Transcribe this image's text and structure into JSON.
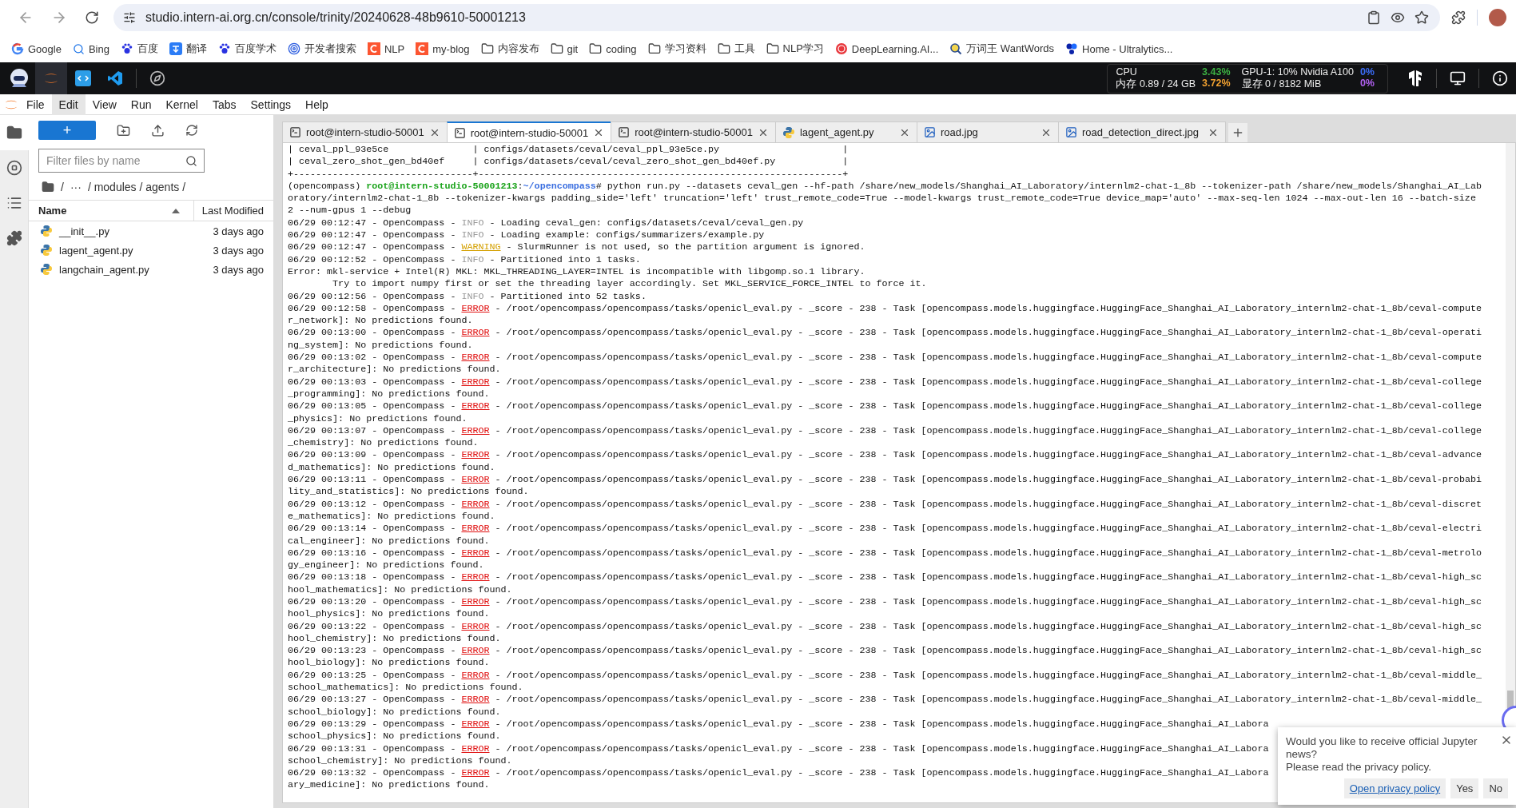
{
  "browser": {
    "url": "studio.intern-ai.org.cn/console/trinity/20240628-48b9610-50001213"
  },
  "bookmarks": [
    {
      "label": "Google",
      "kind": "google"
    },
    {
      "label": "Bing",
      "kind": "search"
    },
    {
      "label": "百度",
      "kind": "paw"
    },
    {
      "label": "翻译",
      "kind": "translate"
    },
    {
      "label": "百度学术",
      "kind": "paw"
    },
    {
      "label": "开发者搜索",
      "kind": "target"
    },
    {
      "label": "NLP",
      "kind": "csdn"
    },
    {
      "label": "my-blog",
      "kind": "csdn"
    },
    {
      "label": "内容发布",
      "kind": "folder"
    },
    {
      "label": "git",
      "kind": "folder"
    },
    {
      "label": "coding",
      "kind": "folder"
    },
    {
      "label": "学习资料",
      "kind": "folder"
    },
    {
      "label": "工具",
      "kind": "folder"
    },
    {
      "label": "NLP学习",
      "kind": "folder"
    },
    {
      "label": "DeepLearning.AI...",
      "kind": "ring"
    },
    {
      "label": "万词王 WantWords",
      "kind": "magnifier"
    },
    {
      "label": "Home - Ultralytics...",
      "kind": "butterfly"
    }
  ],
  "resources": [
    {
      "label": "CPU",
      "value": "3.43%",
      "color": "#3cb043"
    },
    {
      "label": "GPU-1: 10% Nvidia A100",
      "value": "0%",
      "color": "#3b6cf6"
    },
    {
      "label": "内存 0.89 / 24 GB",
      "value": "3.72%",
      "color": "#f0a030"
    },
    {
      "label": "显存 0 / 8182 MiB",
      "value": "0%",
      "color": "#b060f0"
    }
  ],
  "menu": [
    {
      "label": "File",
      "selected": false
    },
    {
      "label": "Edit",
      "selected": true
    },
    {
      "label": "View",
      "selected": false
    },
    {
      "label": "Run",
      "selected": false
    },
    {
      "label": "Kernel",
      "selected": false
    },
    {
      "label": "Tabs",
      "selected": false
    },
    {
      "label": "Settings",
      "selected": false
    },
    {
      "label": "Help",
      "selected": false
    }
  ],
  "side_tabs": [
    {
      "kind": "folder",
      "selected": true
    },
    {
      "kind": "stop",
      "selected": false
    },
    {
      "kind": "list",
      "selected": false
    },
    {
      "kind": "puzzle",
      "selected": false
    }
  ],
  "file_browser": {
    "new_button": "+",
    "filter": {
      "placeholder": "Filter files by name"
    },
    "breadcrumb": [
      "/",
      "···",
      "/ modules / agents /"
    ],
    "columns": [
      "Name",
      "Last Modified"
    ],
    "files": [
      {
        "name": "__init__.py",
        "modified": "3 days ago"
      },
      {
        "name": "lagent_agent.py",
        "modified": "3 days ago"
      },
      {
        "name": "langchain_agent.py",
        "modified": "3 days ago"
      }
    ]
  },
  "tabs": [
    {
      "kind": "terminal",
      "label": "root@intern-studio-50001",
      "selected": false
    },
    {
      "kind": "terminal",
      "label": "root@intern-studio-50001",
      "selected": true
    },
    {
      "kind": "terminal",
      "label": "root@intern-studio-50001",
      "selected": false
    },
    {
      "kind": "python",
      "label": "lagent_agent.py",
      "selected": false
    },
    {
      "kind": "image",
      "label": "road.jpg",
      "selected": false
    },
    {
      "kind": "image",
      "label": "road_detection_direct.jpg",
      "selected": false
    }
  ],
  "terminal": [
    {
      "kind": "text",
      "text": "| ceval_ppl_93e5ce               | configs/datasets/ceval/ceval_ppl_93e5ce.py                      |"
    },
    {
      "kind": "text",
      "text": "| ceval_zero_shot_gen_bd40ef     | configs/datasets/ceval/ceval_zero_shot_gen_bd40ef.py            |"
    },
    {
      "kind": "text",
      "text": "+--------------------------------+-----------------------------------------------------------------+"
    },
    {
      "kind": "prompt",
      "env": "(opencompass) ",
      "user": "root@intern-studio-50001213",
      "sep": ":",
      "path": "~/opencompass",
      "cmd": "# python run.py --datasets ceval_gen --hf-path /share/new_models/Shanghai_AI_Laboratory/internlm2-chat-1_8b --tokenizer-path /share/new_models/Shanghai_AI_Lab"
    },
    {
      "kind": "text",
      "text": "oratory/internlm2-chat-1_8b --tokenizer-kwargs padding_side='left' truncation='left' trust_remote_code=True --model-kwargs trust_remote_code=True device_map='auto' --max-seq-len 1024 --max-out-len 16 --batch-size"
    },
    {
      "kind": "text",
      "text": "2 --num-gpus 1 --debug"
    },
    {
      "kind": "info",
      "head": "06/29 00:12:47 - OpenCompass - ",
      "level": "INFO",
      "tail": " - Loading ceval_gen: configs/datasets/ceval/ceval_gen.py"
    },
    {
      "kind": "info",
      "head": "06/29 00:12:47 - OpenCompass - ",
      "level": "INFO",
      "tail": " - Loading example: configs/summarizers/example.py"
    },
    {
      "kind": "warning",
      "head": "06/29 00:12:47 - OpenCompass - ",
      "level": "WARNING",
      "tail": " - SlurmRunner is not used, so the partition argument is ignored."
    },
    {
      "kind": "info",
      "head": "06/29 00:12:52 - OpenCompass - ",
      "level": "INFO",
      "tail": " - Partitioned into 1 tasks."
    },
    {
      "kind": "text",
      "text": "Error: mkl-service + Intel(R) MKL: MKL_THREADING_LAYER=INTEL is incompatible with libgomp.so.1 library."
    },
    {
      "kind": "text",
      "text": "        Try to import numpy first or set the threading layer accordingly. Set MKL_SERVICE_FORCE_INTEL to force it."
    },
    {
      "kind": "info",
      "head": "06/29 00:12:56 - OpenCompass - ",
      "level": "INFO",
      "tail": " - Partitioned into 52 tasks."
    },
    {
      "kind": "error",
      "head": "06/29 00:12:58 - OpenCompass - ",
      "level": "ERROR",
      "tail": " - /root/opencompass/opencompass/tasks/openicl_eval.py - _score - 238 - Task [opencompass.models.huggingface.HuggingFace_Shanghai_AI_Laboratory_internlm2-chat-1_8b/ceval-compute"
    },
    {
      "kind": "text",
      "text": "r_network]: No predictions found."
    },
    {
      "kind": "error",
      "head": "06/29 00:13:00 - OpenCompass - ",
      "level": "ERROR",
      "tail": " - /root/opencompass/opencompass/tasks/openicl_eval.py - _score - 238 - Task [opencompass.models.huggingface.HuggingFace_Shanghai_AI_Laboratory_internlm2-chat-1_8b/ceval-operati"
    },
    {
      "kind": "text",
      "text": "ng_system]: No predictions found."
    },
    {
      "kind": "error",
      "head": "06/29 00:13:02 - OpenCompass - ",
      "level": "ERROR",
      "tail": " - /root/opencompass/opencompass/tasks/openicl_eval.py - _score - 238 - Task [opencompass.models.huggingface.HuggingFace_Shanghai_AI_Laboratory_internlm2-chat-1_8b/ceval-compute"
    },
    {
      "kind": "text",
      "text": "r_architecture]: No predictions found."
    },
    {
      "kind": "error",
      "head": "06/29 00:13:03 - OpenCompass - ",
      "level": "ERROR",
      "tail": " - /root/opencompass/opencompass/tasks/openicl_eval.py - _score - 238 - Task [opencompass.models.huggingface.HuggingFace_Shanghai_AI_Laboratory_internlm2-chat-1_8b/ceval-college"
    },
    {
      "kind": "text",
      "text": "_programming]: No predictions found."
    },
    {
      "kind": "error",
      "head": "06/29 00:13:05 - OpenCompass - ",
      "level": "ERROR",
      "tail": " - /root/opencompass/opencompass/tasks/openicl_eval.py - _score - 238 - Task [opencompass.models.huggingface.HuggingFace_Shanghai_AI_Laboratory_internlm2-chat-1_8b/ceval-college"
    },
    {
      "kind": "text",
      "text": "_physics]: No predictions found."
    },
    {
      "kind": "error",
      "head": "06/29 00:13:07 - OpenCompass - ",
      "level": "ERROR",
      "tail": " - /root/opencompass/opencompass/tasks/openicl_eval.py - _score - 238 - Task [opencompass.models.huggingface.HuggingFace_Shanghai_AI_Laboratory_internlm2-chat-1_8b/ceval-college"
    },
    {
      "kind": "text",
      "text": "_chemistry]: No predictions found."
    },
    {
      "kind": "error",
      "head": "06/29 00:13:09 - OpenCompass - ",
      "level": "ERROR",
      "tail": " - /root/opencompass/opencompass/tasks/openicl_eval.py - _score - 238 - Task [opencompass.models.huggingface.HuggingFace_Shanghai_AI_Laboratory_internlm2-chat-1_8b/ceval-advance"
    },
    {
      "kind": "text",
      "text": "d_mathematics]: No predictions found."
    },
    {
      "kind": "error",
      "head": "06/29 00:13:11 - OpenCompass - ",
      "level": "ERROR",
      "tail": " - /root/opencompass/opencompass/tasks/openicl_eval.py - _score - 238 - Task [opencompass.models.huggingface.HuggingFace_Shanghai_AI_Laboratory_internlm2-chat-1_8b/ceval-probabi"
    },
    {
      "kind": "text",
      "text": "lity_and_statistics]: No predictions found."
    },
    {
      "kind": "error",
      "head": "06/29 00:13:12 - OpenCompass - ",
      "level": "ERROR",
      "tail": " - /root/opencompass/opencompass/tasks/openicl_eval.py - _score - 238 - Task [opencompass.models.huggingface.HuggingFace_Shanghai_AI_Laboratory_internlm2-chat-1_8b/ceval-discret"
    },
    {
      "kind": "text",
      "text": "e_mathematics]: No predictions found."
    },
    {
      "kind": "error",
      "head": "06/29 00:13:14 - OpenCompass - ",
      "level": "ERROR",
      "tail": " - /root/opencompass/opencompass/tasks/openicl_eval.py - _score - 238 - Task [opencompass.models.huggingface.HuggingFace_Shanghai_AI_Laboratory_internlm2-chat-1_8b/ceval-electri"
    },
    {
      "kind": "text",
      "text": "cal_engineer]: No predictions found."
    },
    {
      "kind": "error",
      "head": "06/29 00:13:16 - OpenCompass - ",
      "level": "ERROR",
      "tail": " - /root/opencompass/opencompass/tasks/openicl_eval.py - _score - 238 - Task [opencompass.models.huggingface.HuggingFace_Shanghai_AI_Laboratory_internlm2-chat-1_8b/ceval-metrolo"
    },
    {
      "kind": "text",
      "text": "gy_engineer]: No predictions found."
    },
    {
      "kind": "error",
      "head": "06/29 00:13:18 - OpenCompass - ",
      "level": "ERROR",
      "tail": " - /root/opencompass/opencompass/tasks/openicl_eval.py - _score - 238 - Task [opencompass.models.huggingface.HuggingFace_Shanghai_AI_Laboratory_internlm2-chat-1_8b/ceval-high_sc"
    },
    {
      "kind": "text",
      "text": "hool_mathematics]: No predictions found."
    },
    {
      "kind": "error",
      "head": "06/29 00:13:20 - OpenCompass - ",
      "level": "ERROR",
      "tail": " - /root/opencompass/opencompass/tasks/openicl_eval.py - _score - 238 - Task [opencompass.models.huggingface.HuggingFace_Shanghai_AI_Laboratory_internlm2-chat-1_8b/ceval-high_sc"
    },
    {
      "kind": "text",
      "text": "hool_physics]: No predictions found."
    },
    {
      "kind": "error",
      "head": "06/29 00:13:22 - OpenCompass - ",
      "level": "ERROR",
      "tail": " - /root/opencompass/opencompass/tasks/openicl_eval.py - _score - 238 - Task [opencompass.models.huggingface.HuggingFace_Shanghai_AI_Laboratory_internlm2-chat-1_8b/ceval-high_sc"
    },
    {
      "kind": "text",
      "text": "hool_chemistry]: No predictions found."
    },
    {
      "kind": "error",
      "head": "06/29 00:13:23 - OpenCompass - ",
      "level": "ERROR",
      "tail": " - /root/opencompass/opencompass/tasks/openicl_eval.py - _score - 238 - Task [opencompass.models.huggingface.HuggingFace_Shanghai_AI_Laboratory_internlm2-chat-1_8b/ceval-high_sc"
    },
    {
      "kind": "text",
      "text": "hool_biology]: No predictions found."
    },
    {
      "kind": "error",
      "head": "06/29 00:13:25 - OpenCompass - ",
      "level": "ERROR",
      "tail": " - /root/opencompass/opencompass/tasks/openicl_eval.py - _score - 238 - Task [opencompass.models.huggingface.HuggingFace_Shanghai_AI_Laboratory_internlm2-chat-1_8b/ceval-middle_"
    },
    {
      "kind": "text",
      "text": "school_mathematics]: No predictions found."
    },
    {
      "kind": "error",
      "head": "06/29 00:13:27 - OpenCompass - ",
      "level": "ERROR",
      "tail": " - /root/opencompass/opencompass/tasks/openicl_eval.py - _score - 238 - Task [opencompass.models.huggingface.HuggingFace_Shanghai_AI_Laboratory_internlm2-chat-1_8b/ceval-middle_"
    },
    {
      "kind": "text",
      "text": "school_biology]: No predictions found."
    },
    {
      "kind": "error",
      "head": "06/29 00:13:29 - OpenCompass - ",
      "level": "ERROR",
      "tail": " - /root/opencompass/opencompass/tasks/openicl_eval.py - _score - 238 - Task [opencompass.models.huggingface.HuggingFace_Shanghai_AI_Labora"
    },
    {
      "kind": "text",
      "text": "school_physics]: No predictions found."
    },
    {
      "kind": "error",
      "head": "06/29 00:13:31 - OpenCompass - ",
      "level": "ERROR",
      "tail": " - /root/opencompass/opencompass/tasks/openicl_eval.py - _score - 238 - Task [opencompass.models.huggingface.HuggingFace_Shanghai_AI_Labora"
    },
    {
      "kind": "text",
      "text": "school_chemistry]: No predictions found."
    },
    {
      "kind": "error",
      "head": "06/29 00:13:32 - OpenCompass - ",
      "level": "ERROR",
      "tail": " - /root/opencompass/opencompass/tasks/openicl_eval.py - _score - 238 - Task [opencompass.models.huggingface.HuggingFace_Shanghai_AI_Labora"
    },
    {
      "kind": "text",
      "text": "ary_medicine]: No predictions found."
    }
  ],
  "notification": {
    "message": "Would you like to receive official Jupyter news?",
    "note": "Please read the privacy policy.",
    "link": "Open privacy policy",
    "buttons": [
      "Yes",
      "No"
    ]
  }
}
